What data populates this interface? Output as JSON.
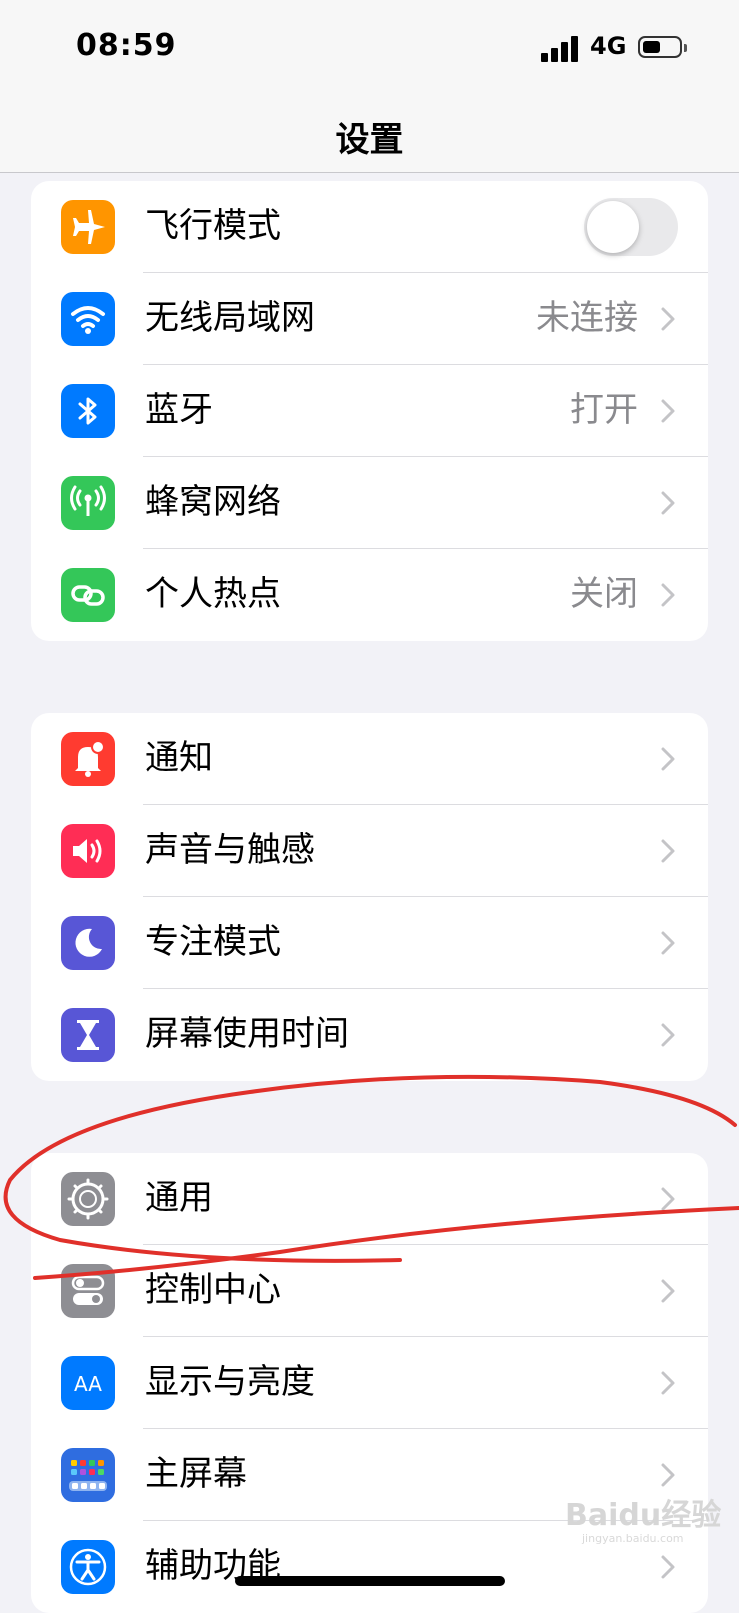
{
  "status_bar": {
    "time": "08:59",
    "network": "4G",
    "battery_level": 0.5
  },
  "nav": {
    "title": "设置"
  },
  "groups": [
    {
      "items": [
        {
          "label": "飞行模式",
          "icon": "airplane-icon",
          "icon_color": "#ff9500",
          "control": "toggle",
          "toggle_on": false
        },
        {
          "label": "无线局域网",
          "icon": "wifi-icon",
          "icon_color": "#007aff",
          "value": "未连接"
        },
        {
          "label": "蓝牙",
          "icon": "bluetooth-icon",
          "icon_color": "#007aff",
          "value": "打开"
        },
        {
          "label": "蜂窝网络",
          "icon": "cellular-icon",
          "icon_color": "#34c759"
        },
        {
          "label": "个人热点",
          "icon": "hotspot-icon",
          "icon_color": "#34c759",
          "value": "关闭"
        }
      ]
    },
    {
      "items": [
        {
          "label": "通知",
          "icon": "notification-icon",
          "icon_color": "#ff3b30"
        },
        {
          "label": "声音与触感",
          "icon": "sound-icon",
          "icon_color": "#ff2d55"
        },
        {
          "label": "专注模式",
          "icon": "moon-icon",
          "icon_color": "#5856d6"
        },
        {
          "label": "屏幕使用时间",
          "icon": "hourglass-icon",
          "icon_color": "#5856d6"
        }
      ]
    },
    {
      "items": [
        {
          "label": "通用",
          "icon": "gear-icon",
          "icon_color": "#8e8e93"
        },
        {
          "label": "控制中心",
          "icon": "control-center-icon",
          "icon_color": "#8e8e93"
        },
        {
          "label": "显示与亮度",
          "icon": "display-brightness-icon",
          "icon_color": "#007aff"
        },
        {
          "label": "主屏幕",
          "icon": "home-screen-icon",
          "icon_color": "#2f6de0"
        },
        {
          "label": "辅助功能",
          "icon": "accessibility-icon",
          "icon_color": "#007aff"
        }
      ]
    }
  ],
  "watermark": {
    "text": "Baidu经验",
    "sub": "jingyan.baidu.com"
  }
}
